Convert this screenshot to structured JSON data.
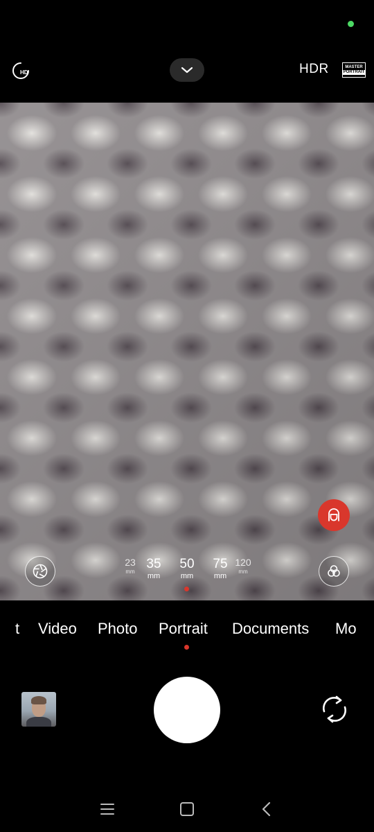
{
  "status": {
    "indicator_color": "#4cd964"
  },
  "topbar": {
    "hd_icon": "hd-timer-icon",
    "hd_label": "HD",
    "more_icon": "chevron-down-icon",
    "hdr_label": "HDR",
    "master_line1": "MASTER",
    "master_line2": "PORTRAIT"
  },
  "viewfinder": {
    "beauty_icon": "face-beauty-icon",
    "beauty_color": "#d9372c",
    "aperture_icon": "aperture-icon",
    "filter_icon": "filters-icon",
    "focal_lengths": [
      {
        "value": "23",
        "unit": "mm"
      },
      {
        "value": "35",
        "unit": "mm"
      },
      {
        "value": "50",
        "unit": "mm"
      },
      {
        "value": "75",
        "unit": "mm"
      },
      {
        "value": "120",
        "unit": "mm"
      }
    ],
    "selected_focal": "50",
    "indicator_color": "#d9372c"
  },
  "modes": {
    "items": [
      "t",
      "Video",
      "Photo",
      "Portrait",
      "Documents",
      "Mo"
    ],
    "selected": "Portrait",
    "indicator_color": "#d9372c"
  },
  "bottom": {
    "gallery_icon": "gallery-thumbnail",
    "shutter_icon": "shutter-button",
    "switch_icon": "switch-camera-icon"
  },
  "navbar": {
    "menu_icon": "menu-icon",
    "home_icon": "home-icon",
    "back_icon": "back-icon"
  }
}
